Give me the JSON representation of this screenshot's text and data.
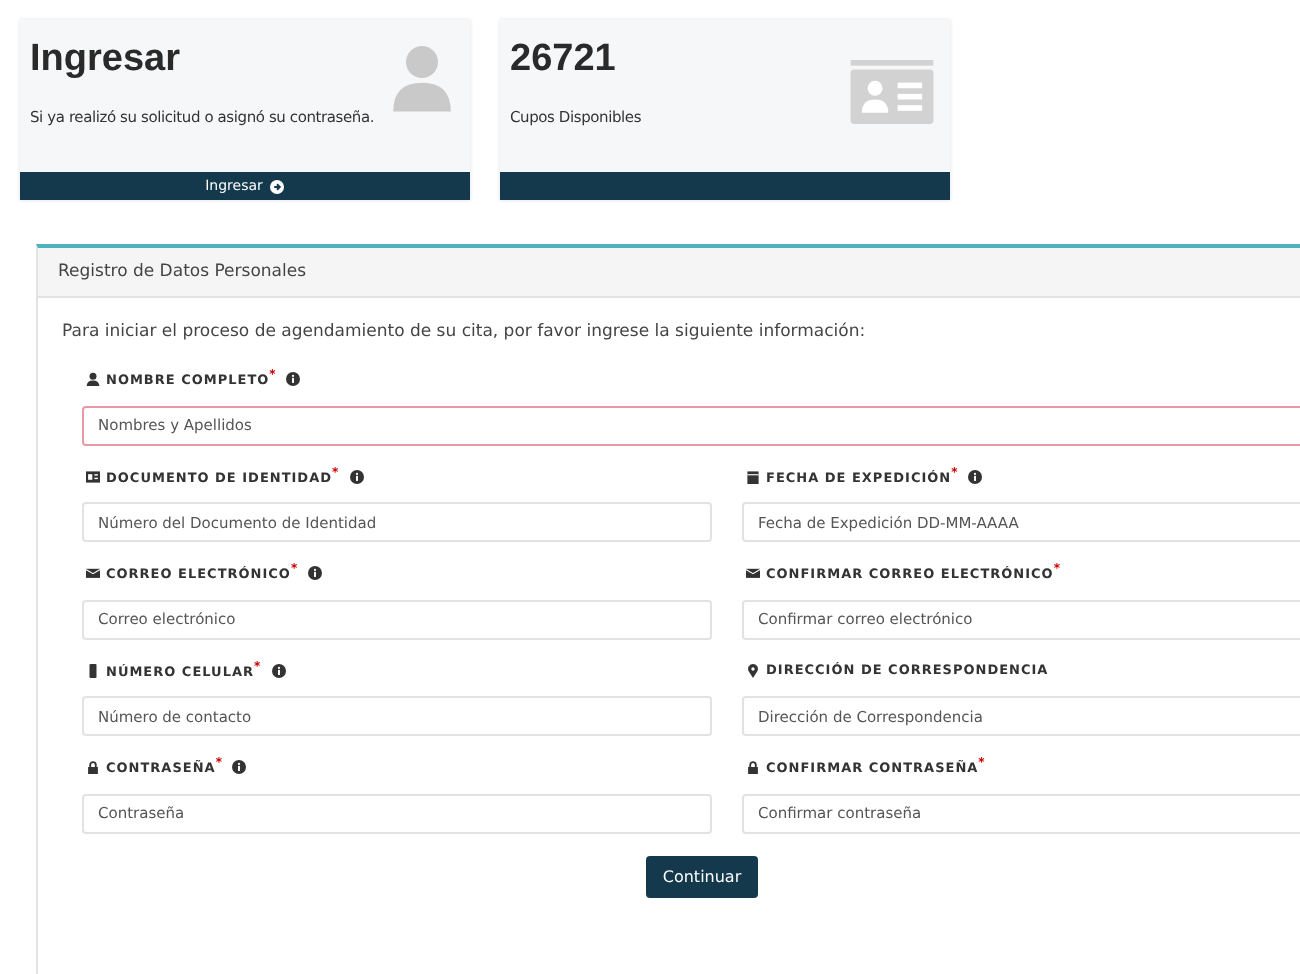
{
  "cards": [
    {
      "kind": "login",
      "title": "Ingresar",
      "text": "Si ya realizó su solicitud o asignó su contraseña.",
      "footer": "Ingresar"
    },
    {
      "kind": "count",
      "title": "26721",
      "text": "Cupos Disponibles"
    }
  ],
  "form": {
    "header": "Registro de Datos Personales",
    "intro": "Para iniciar el proceso de agendamiento de su cita, por favor ingrese la siguiente información:",
    "rows": [
      [
        {
          "kind": "user",
          "label": "NOMBRE COMPLETO$^{*}$",
          "info": true,
          "placeholder": "Nombres y Apellidos",
          "invalid": true
        }
      ],
      [
        {
          "kind": "idcard",
          "label": "DOCUMENTO DE IDENTIDAD$^{*}$",
          "info": true,
          "placeholder": "Número del Documento de Identidad",
          "invalid": false
        },
        {
          "kind": "calendar",
          "label": "FECHA DE EXPEDICIÓN$^{*}$",
          "info": true,
          "placeholder": "Fecha de Expedición DD-MM-AAAA",
          "invalid": false
        }
      ],
      [
        {
          "kind": "envelope",
          "label": "CORREO ELECTRÓNICO$^{*}$",
          "info": true,
          "placeholder": "Correo electrónico",
          "invalid": false
        },
        {
          "kind": "envelope",
          "label": "CONFIRMAR CORREO ELECTRÓNICO$^{*}$",
          "info": false,
          "placeholder": "Confirmar correo electrónico",
          "invalid": false
        }
      ],
      [
        {
          "kind": "mobile",
          "label": "NÚMERO CELULAR$^{*}$",
          "info": true,
          "placeholder": "Número de contacto",
          "invalid": false
        },
        {
          "kind": "marker",
          "label": "DIRECCIÓN DE CORRESPONDENCIA",
          "info": false,
          "placeholder": "Dirección de Correspondencia",
          "invalid": false
        }
      ],
      [
        {
          "kind": "lock",
          "label": "CONTRASEÑA$^{*}$",
          "info": true,
          "placeholder": "Contraseña",
          "invalid": false
        },
        {
          "kind": "lock",
          "label": "CONFIRMAR CONTRASEÑA$^{*}$",
          "info": false,
          "placeholder": "Confirmar contraseña",
          "invalid": false
        }
      ]
    ],
    "button": "Continuar"
  }
}
